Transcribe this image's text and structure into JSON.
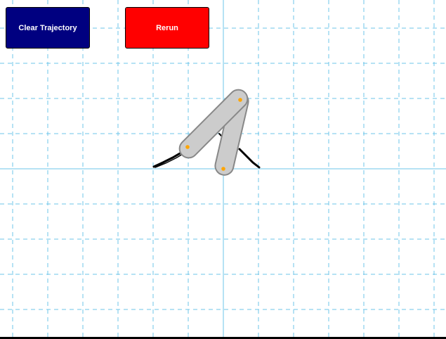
{
  "toolbar": {
    "clear_label": "Clear Trajectory",
    "rerun_label": "Rerun"
  },
  "colors": {
    "clear_button": "#000080",
    "rerun_button": "#ff0000",
    "grid_line": "#6ec6ea",
    "link_fill": "#cccccc",
    "link_stroke": "#888888",
    "joint_marker": "#ffa500",
    "trajectory": "#000000"
  },
  "grid": {
    "minor_style": "dashed",
    "major_style": "solid"
  },
  "icons": {
    "arm": "two-link-robot-arm-icon",
    "joint": "joint-marker-icon"
  }
}
